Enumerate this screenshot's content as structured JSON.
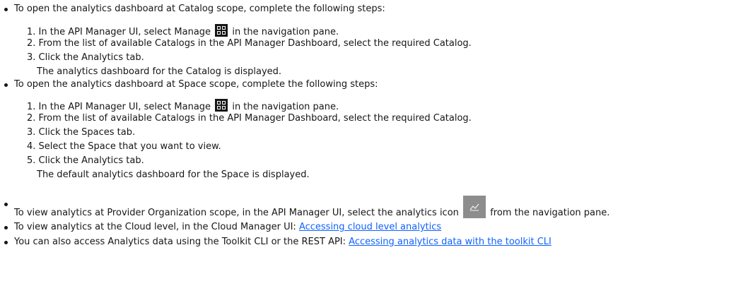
{
  "items": {
    "catalog_intro": "To open the analytics dashboard at Catalog scope, complete the following steps:",
    "catalog_step1_num": "1.",
    "catalog_step1_a": "In the API Manager UI, select Manage",
    "catalog_step1_b": "in the navigation pane.",
    "catalog_step2": "2. From the list of available Catalogs in the API Manager Dashboard, select the required Catalog.",
    "catalog_step3": "3. Click the Analytics tab.",
    "catalog_step3_result": "The analytics dashboard for the Catalog is displayed.",
    "space_intro": "To open the analytics dashboard at Space scope, complete the following steps:",
    "space_step1_num": "1.",
    "space_step1_a": "In the API Manager UI, select Manage",
    "space_step1_b": "in the navigation pane.",
    "space_step2": "2. From the list of available Catalogs in the API Manager Dashboard, select the required Catalog.",
    "space_step3": "3. Click the Spaces tab.",
    "space_step4": "4. Select the Space that you want to view.",
    "space_step5": "5. Click the Analytics tab.",
    "space_step5_result": "The default analytics dashboard for the Space is displayed.",
    "provider_a": "To view analytics at Provider Organization scope, in the API Manager UI, select the analytics icon",
    "provider_b": "from the navigation pane.",
    "cloud_text": "To view analytics at the Cloud level, in the Cloud Manager UI: ",
    "cloud_link": "Accessing cloud level analytics",
    "toolkit_text": "You can also access Analytics data using the Toolkit CLI or the REST API: ",
    "toolkit_link": "Accessing analytics data with the toolkit CLI"
  },
  "icons": {
    "manage": "grid-icon",
    "analytics": "analytics-chart-icon"
  }
}
